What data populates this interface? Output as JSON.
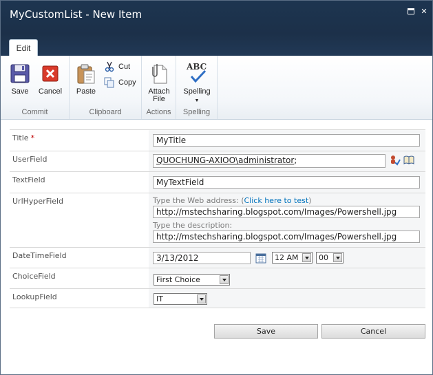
{
  "window": {
    "title": "MyCustomList - New Item",
    "close_glyph": "✕"
  },
  "ribbon": {
    "tab": "Edit",
    "groups": {
      "commit": {
        "label": "Commit",
        "save": "Save",
        "cancel": "Cancel"
      },
      "clipboard": {
        "label": "Clipboard",
        "paste": "Paste",
        "cut": "Cut",
        "copy": "Copy"
      },
      "actions": {
        "label": "Actions",
        "attach_line1": "Attach",
        "attach_line2": "File"
      },
      "spelling": {
        "label": "Spelling",
        "spelling": "Spelling",
        "abc": "ABC"
      }
    }
  },
  "form": {
    "title": {
      "label": "Title",
      "required_mark": "*",
      "value": "MyTitle"
    },
    "user": {
      "label": "UserField",
      "value": "QUOCHUNG-AXIOO\\administrator",
      "suffix": ";"
    },
    "text": {
      "label": "TextField",
      "value": "MyTextField"
    },
    "url": {
      "label": "UrlHyperField",
      "address_hint": "Type the Web address: (",
      "test_link": "Click here to test",
      "address_hint_end": ")",
      "address_value": "http://mstechsharing.blogspot.com/Images/Powershell.jpg",
      "description_hint": "Type the description:",
      "description_value": "http://mstechsharing.blogspot.com/Images/Powershell.jpg"
    },
    "datetime": {
      "label": "DateTimeField",
      "date": "3/13/2012",
      "hour": "12 AM",
      "minute": "00"
    },
    "choice": {
      "label": "ChoiceField",
      "value": "First Choice"
    },
    "lookup": {
      "label": "LookupField",
      "value": "IT"
    }
  },
  "buttons": {
    "save": "Save",
    "cancel": "Cancel"
  },
  "colors": {
    "title_bar": "#1c3049",
    "link": "#0072bc",
    "required": "#bf0000"
  }
}
